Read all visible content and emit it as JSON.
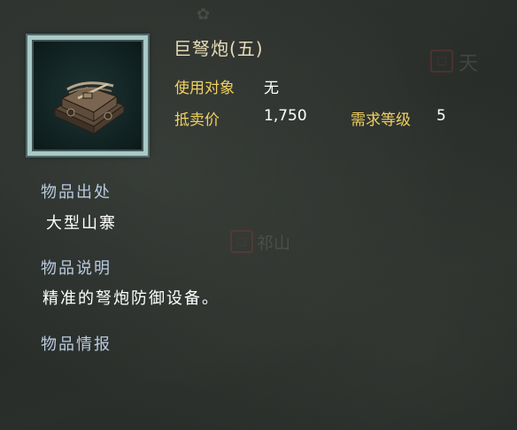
{
  "item": {
    "name": "巨弩炮(五)",
    "icon": "crossbow-cannon-icon",
    "use_target_label": "使用对象",
    "use_target_value": "无",
    "price_label": "抵卖价",
    "price_value": "1,750",
    "level_label": "需求等级",
    "level_value": "5"
  },
  "sections": {
    "origin": {
      "heading": "物品出处",
      "text": "大型山寨"
    },
    "description": {
      "heading": "物品说明",
      "text": "精准的弩炮防御设备。"
    },
    "intel": {
      "heading": "物品情报"
    }
  },
  "background_map": {
    "place_1": "天",
    "place_2": "祁山"
  },
  "colors": {
    "gold_label": "#f0d060",
    "section_heading": "#b9cbe0",
    "frame_border": "#a9c8c6",
    "background": "#2b2f2b"
  }
}
